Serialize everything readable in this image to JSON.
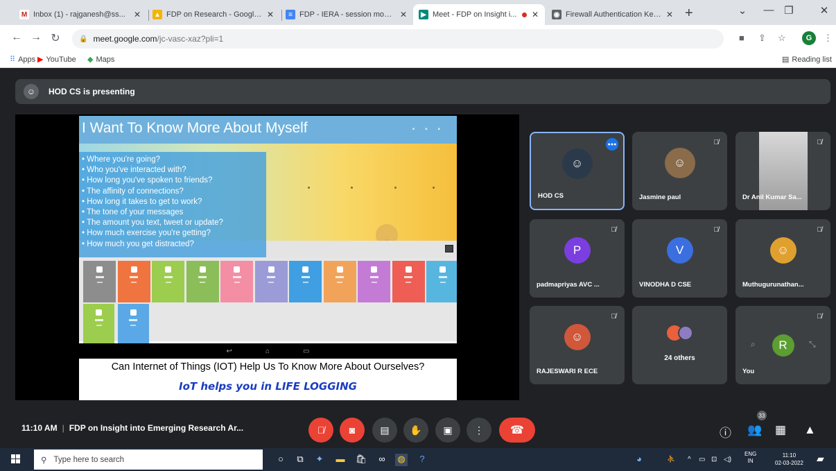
{
  "browser": {
    "tabs": [
      {
        "title": "Inbox (1) - rajganesh@ss...",
        "favicon": "gmail-icon",
        "color": "#c5221f",
        "active": false
      },
      {
        "title": "FDP on Research - Google D...",
        "favicon": "drive-icon",
        "color": "#f4b400",
        "active": false
      },
      {
        "title": "FDP - IERA - session monito...",
        "favicon": "forms-icon",
        "color": "#4285f4",
        "active": false
      },
      {
        "title": "Meet - FDP on Insight i...",
        "favicon": "meet-icon",
        "color": "#00897b",
        "active": true,
        "recording": true
      },
      {
        "title": "Firewall Authentication Kee...",
        "favicon": "globe-icon",
        "color": "#5f6368",
        "active": false
      }
    ],
    "url_domain": "meet.google.com",
    "url_path": "/jc-vasc-xaz?pli=1",
    "profile_initial": "G",
    "bookmarks": [
      "Apps",
      "YouTube",
      "Maps"
    ],
    "reading_list": "Reading list"
  },
  "meet": {
    "presenting_banner": "HOD CS is presenting",
    "slide": {
      "title": "I Want To Know More About Myself",
      "bullets": [
        "Where you're going?",
        "Who you've interacted with?",
        "How long you've spoken to friends?",
        "The affinity of connections?",
        "How long it takes to get to work?",
        "The tone of your messages",
        "The amount you text, tweet or update?",
        "How much exercise you're getting?",
        "How much you get distracted?"
      ],
      "tile_colors": [
        "#8d8d8d",
        "#f0743f",
        "#9ccd4e",
        "#8bbd58",
        "#f48ea4",
        "#9b9bd8",
        "#3f9fe2",
        "#f2a35a",
        "#c37bd6",
        "#ee5e54",
        "#57b6e0",
        "#9ccd4e",
        "#5aa9e6"
      ],
      "caption": "Can Internet of Things (IOT) Help Us To Know More About Ourselves?",
      "caption_emphasis": "IoT helps you in LIFE LOGGING"
    },
    "participants": [
      {
        "name": "HOD CS",
        "kind": "photo",
        "speaking": true
      },
      {
        "name": "Jasmine paul",
        "kind": "photo"
      },
      {
        "name": "Dr Anil Kumar Sa...",
        "kind": "camera"
      },
      {
        "name": "padmapriyas AVC ...",
        "kind": "initial",
        "initial": "P",
        "color": "#7b3ee0"
      },
      {
        "name": "VINODHA D CSE",
        "kind": "initial",
        "initial": "V",
        "color": "#3b6fe0"
      },
      {
        "name": "Muthugurunathan...",
        "kind": "photo"
      },
      {
        "name": "RAJESWARI R ECE",
        "kind": "photo"
      },
      {
        "name": "24 others",
        "kind": "group"
      },
      {
        "name": "You",
        "kind": "initial",
        "initial": "R",
        "color": "#5c9e31"
      }
    ],
    "time": "11:10 AM",
    "meeting_title": "FDP on Insight into Emerging Research Ar...",
    "people_count": "33"
  },
  "taskbar": {
    "search_placeholder": "Type here to search",
    "lang_top": "ENG",
    "lang_bottom": "IN",
    "clock_time": "11:10",
    "clock_date": "02-03-2022"
  }
}
